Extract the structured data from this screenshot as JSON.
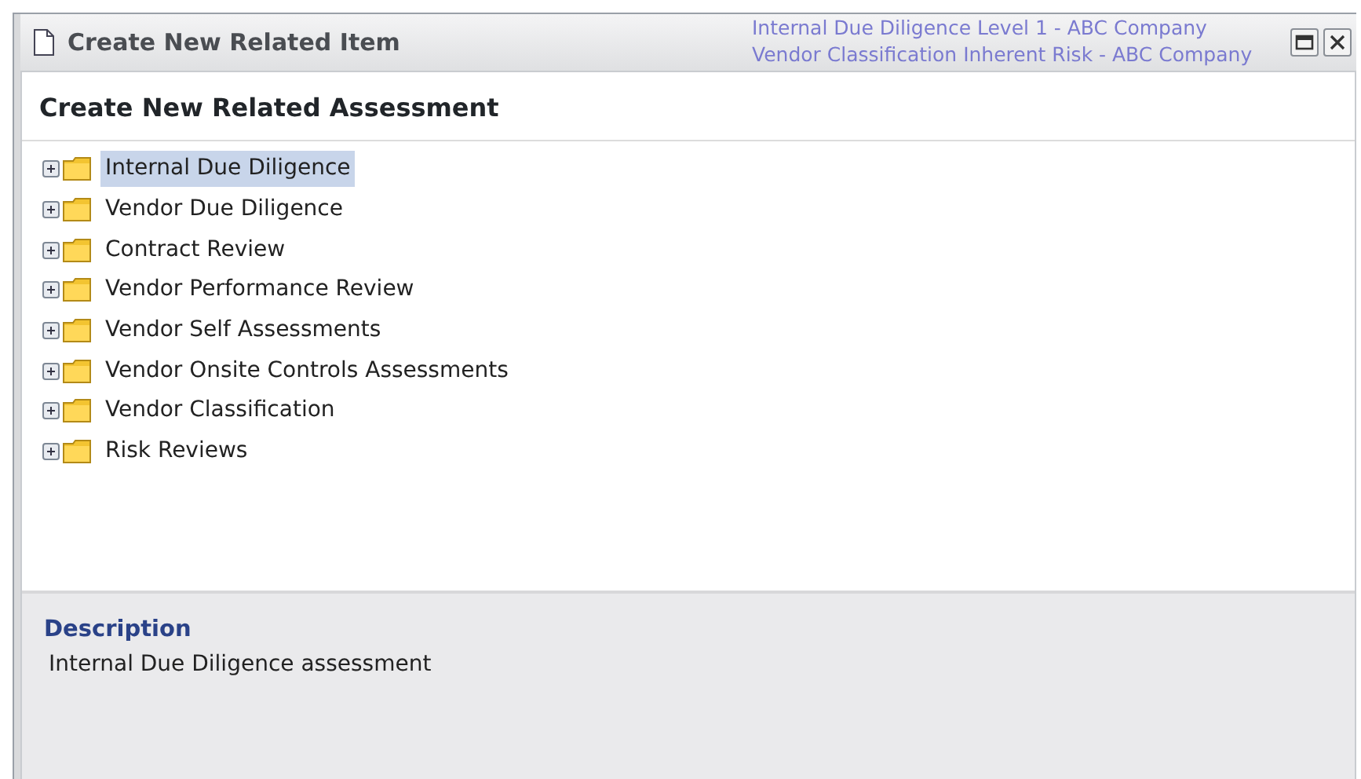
{
  "background_links": [
    "Internal Due Diligence Level 1 - ABC Company",
    "Vendor Classification Inherent Risk - ABC Company"
  ],
  "window": {
    "title": "Create New Related Item"
  },
  "heading": "Create New Related Assessment",
  "tree": [
    {
      "label": "Internal Due Diligence",
      "selected": true,
      "expanded": false
    },
    {
      "label": "Vendor Due Diligence",
      "selected": false,
      "expanded": false
    },
    {
      "label": "Contract Review",
      "selected": false,
      "expanded": false
    },
    {
      "label": "Vendor Performance Review",
      "selected": false,
      "expanded": false
    },
    {
      "label": "Vendor Self Assessments",
      "selected": false,
      "expanded": false
    },
    {
      "label": "Vendor Onsite Controls Assessments",
      "selected": false,
      "expanded": false
    },
    {
      "label": "Vendor Classification",
      "selected": false,
      "expanded": false
    },
    {
      "label": "Risk Reviews",
      "selected": false,
      "expanded": false
    }
  ],
  "description": {
    "title": "Description",
    "text": "Internal Due Diligence assessment"
  }
}
